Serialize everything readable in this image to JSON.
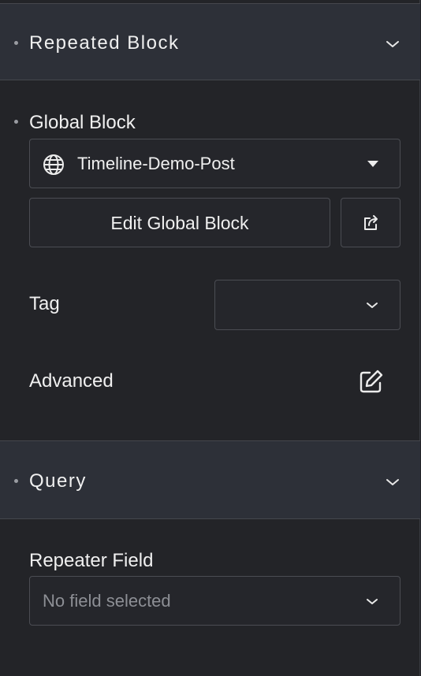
{
  "sections": {
    "repeated_block": {
      "title": "Repeated Block"
    },
    "query": {
      "title": "Query"
    }
  },
  "global_block": {
    "label": "Global Block",
    "selected": "Timeline-Demo-Post",
    "edit_button": "Edit Global Block"
  },
  "tag": {
    "label": "Tag",
    "value": ""
  },
  "advanced": {
    "label": "Advanced"
  },
  "repeater": {
    "label": "Repeater Field",
    "placeholder": "No field selected"
  },
  "icons": {
    "globe": "globe-icon",
    "dropdown": "caret-down-icon",
    "external": "external-link-icon",
    "chevron": "chevron-down-icon",
    "edit": "edit-icon"
  }
}
